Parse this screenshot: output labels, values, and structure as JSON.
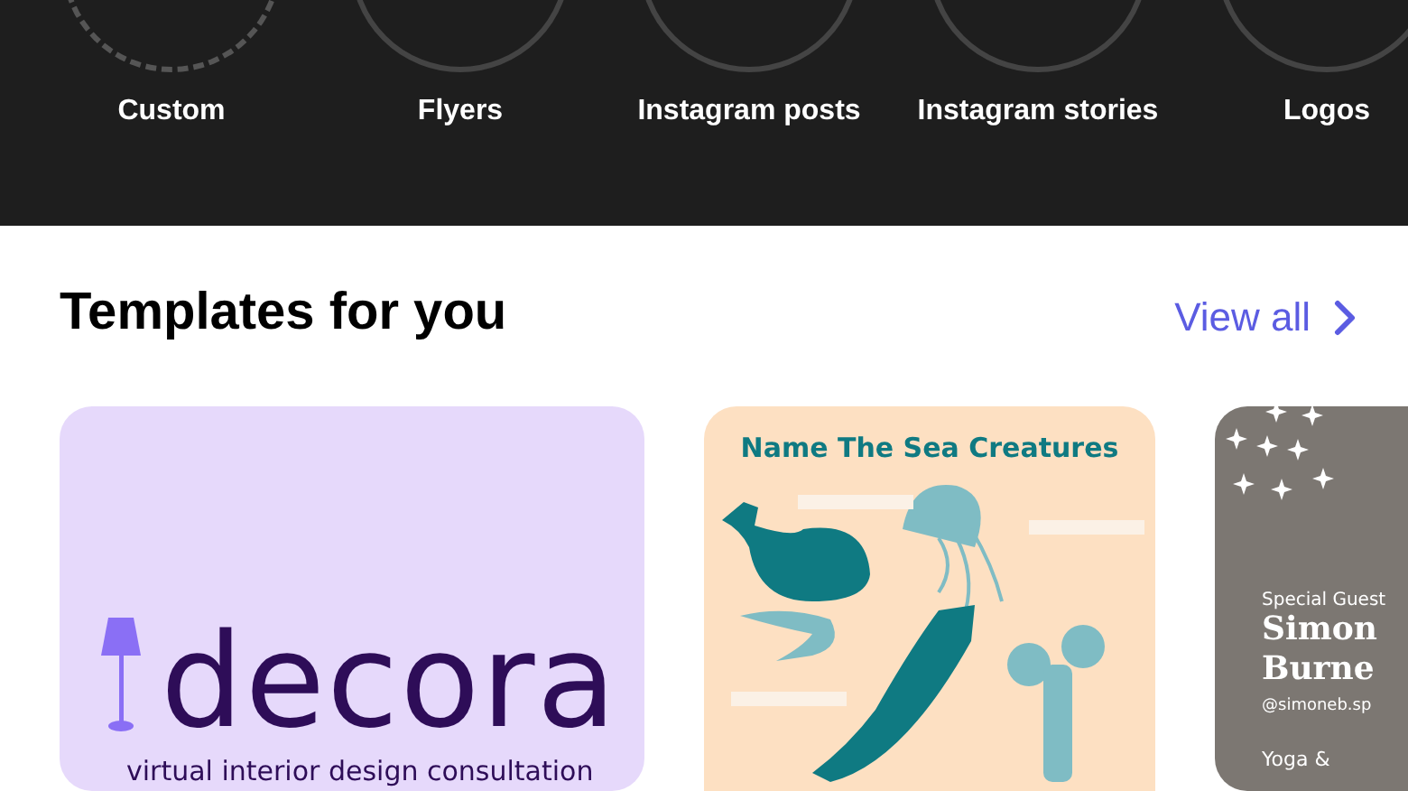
{
  "categories": [
    {
      "label": "Custom",
      "kind": "custom"
    },
    {
      "label": "Flyers",
      "kind": "preset"
    },
    {
      "label": "Instagram posts",
      "kind": "preset"
    },
    {
      "label": "Instagram stories",
      "kind": "preset"
    },
    {
      "label": "Logos",
      "kind": "preset"
    }
  ],
  "templates_section": {
    "title": "Templates for you",
    "view_all": "View all"
  },
  "templates": [
    {
      "kind": "logo",
      "brand": "decora",
      "tagline": "virtual interior design consultation"
    },
    {
      "kind": "worksheet",
      "title": "Name The Sea Creatures"
    },
    {
      "kind": "story",
      "eyebrow": "Special Guest",
      "name_lines": [
        "Simon",
        "Burne"
      ],
      "handle": "@simoneb.sp",
      "footer": "Yoga &"
    }
  ]
}
